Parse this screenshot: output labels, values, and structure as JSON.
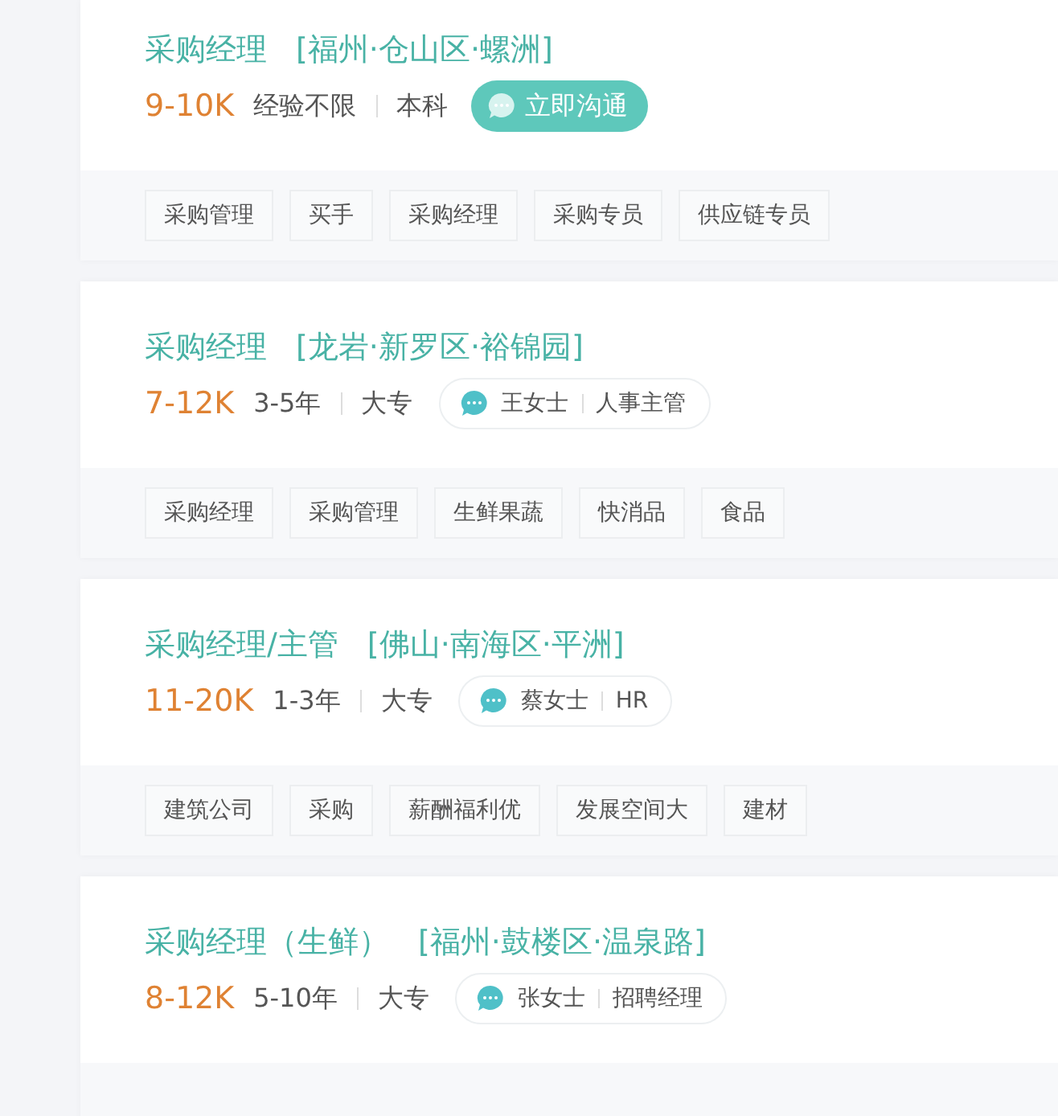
{
  "jobs": [
    {
      "title": "采购经理",
      "location": "[福州·仓山区·螺洲]",
      "salary": "9-10K",
      "experience": "经验不限",
      "education": "本科",
      "contact": {
        "kind": "chat_button",
        "label": "立即沟通"
      },
      "tags": [
        "采购管理",
        "买手",
        "采购经理",
        "采购专员",
        "供应链专员"
      ]
    },
    {
      "title": "采购经理",
      "location": "[龙岩·新罗区·裕锦园]",
      "salary": "7-12K",
      "experience": "3-5年",
      "education": "大专",
      "contact": {
        "kind": "recruiter",
        "name": "王女士",
        "role": "人事主管"
      },
      "tags": [
        "采购经理",
        "采购管理",
        "生鲜果蔬",
        "快消品",
        "食品"
      ]
    },
    {
      "title": "采购经理/主管",
      "location": "[佛山·南海区·平洲]",
      "salary": "11-20K",
      "experience": "1-3年",
      "education": "大专",
      "contact": {
        "kind": "recruiter",
        "name": "蔡女士",
        "role": "HR"
      },
      "tags": [
        "建筑公司",
        "采购",
        "薪酬福利优",
        "发展空间大",
        "建材"
      ]
    },
    {
      "title": "采购经理（生鲜）",
      "location": "[福州·鼓楼区·温泉路]",
      "salary": "8-12K",
      "experience": "5-10年",
      "education": "大专",
      "contact": {
        "kind": "recruiter",
        "name": "张女士",
        "role": "招聘经理"
      }
    }
  ]
}
